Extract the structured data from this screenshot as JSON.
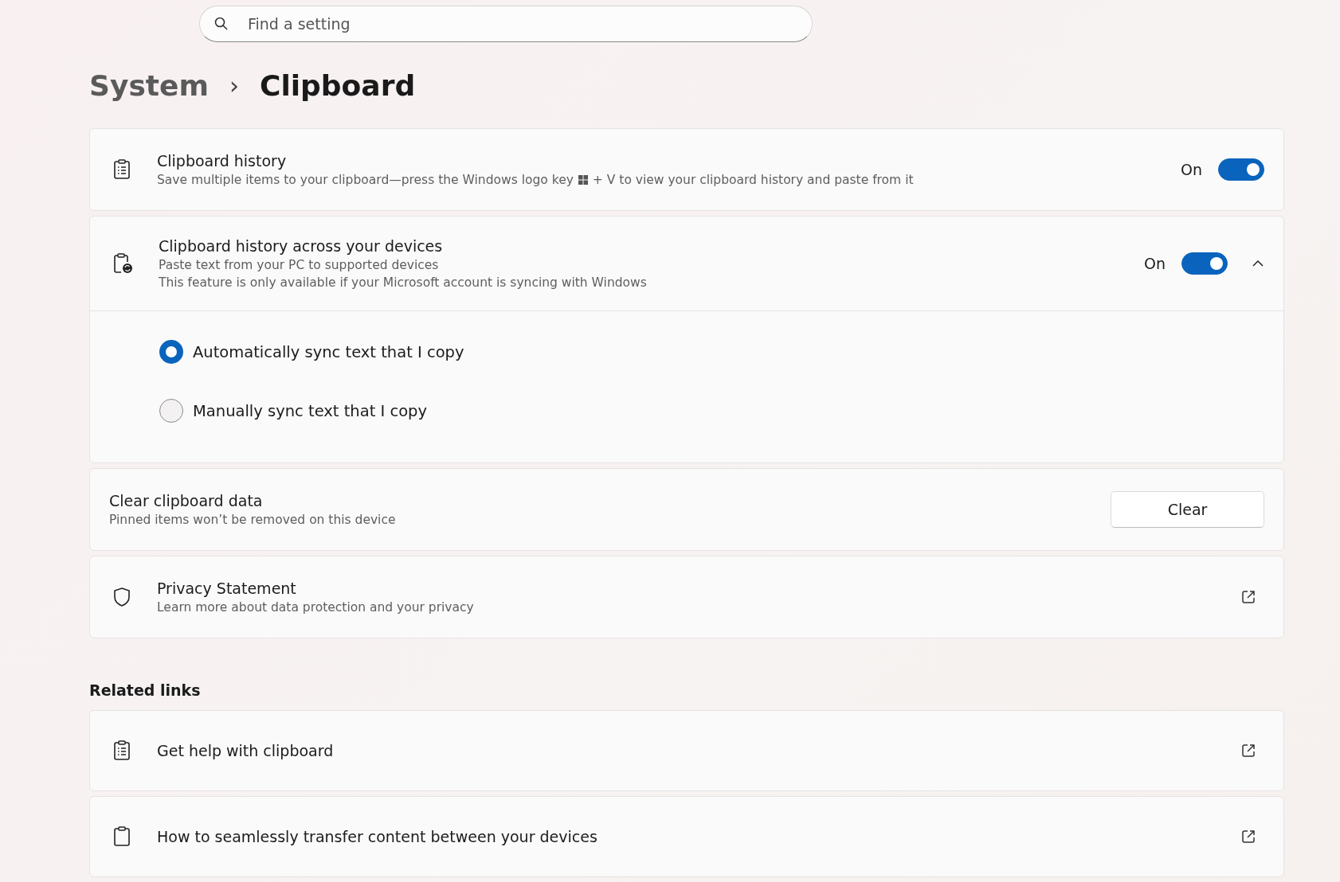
{
  "search": {
    "placeholder": "Find a setting"
  },
  "breadcrumb": {
    "parent": "System",
    "separator": "›",
    "current": "Clipboard"
  },
  "settings": [
    {
      "kind": "toggle",
      "title": "Clipboard history",
      "description_parts": [
        "Save multiple items to your clipboard—press the Windows logo key",
        "+ V to view your clipboard history and paste from it"
      ],
      "state_label": "On",
      "on": true
    },
    {
      "kind": "toggle",
      "title": "Clipboard history across your devices",
      "description_lines": [
        "Paste text from your PC to supported devices",
        "This feature is only available if your Microsoft account is syncing with Windows"
      ],
      "state_label": "On",
      "on": true,
      "expanded": true,
      "options": [
        {
          "label": "Automatically sync text that I copy",
          "selected": true
        },
        {
          "label": "Manually sync text that I copy",
          "selected": false
        }
      ]
    },
    {
      "kind": "button",
      "title": "Clear clipboard data",
      "description_lines": [
        "Pinned items won’t be removed on this device"
      ],
      "button": "Clear"
    },
    {
      "kind": "link",
      "title": "Privacy Statement",
      "description_lines": [
        "Learn more about data protection and your privacy"
      ]
    }
  ],
  "related_links": {
    "heading": "Related links",
    "items": [
      {
        "label": "Get help with clipboard"
      },
      {
        "label": "How to seamlessly transfer content between your devices"
      }
    ]
  }
}
